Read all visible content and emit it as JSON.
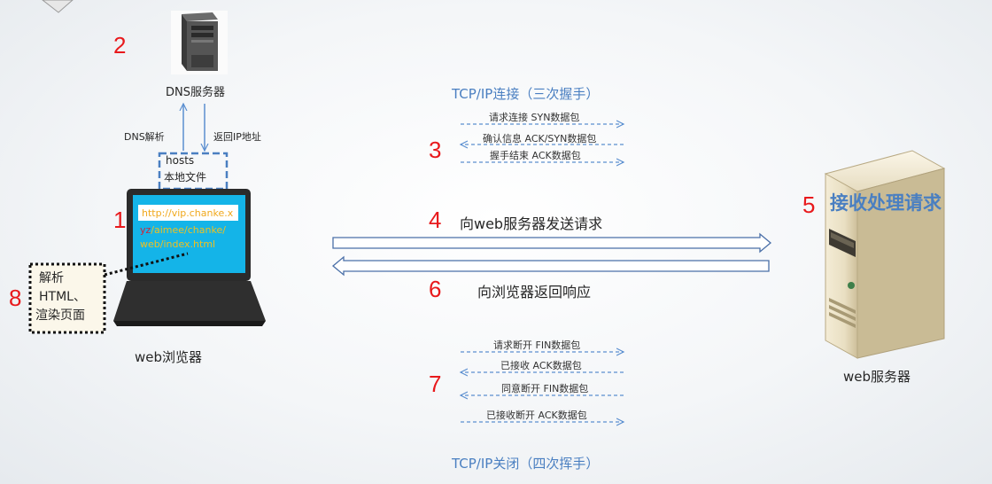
{
  "dns": {
    "number": "2",
    "label": "DNS服务器",
    "resolve_label": "DNS解析",
    "return_label": "返回IP地址"
  },
  "hosts": {
    "line1": "hosts",
    "line2": "本地文件"
  },
  "browser": {
    "number": "1",
    "label": "web浏览器",
    "url_line1": "http://vip.chanke.x",
    "url_line2_a": "yz",
    "url_line2_b": "/aimee/chanke/",
    "url_line3": "web/index.html"
  },
  "render": {
    "number": "8",
    "line1": "解析",
    "line2": "HTML、",
    "line3": "渲染页面"
  },
  "handshake": {
    "title": "TCP/IP连接（三次握手）",
    "number": "3",
    "packets": [
      "请求连接 SYN数据包",
      "确认信息 ACK/SYN数据包",
      "握手结束 ACK数据包"
    ]
  },
  "request": {
    "number": "4",
    "label": "向web服务器发送请求"
  },
  "response": {
    "number": "6",
    "label": "向浏览器返回响应"
  },
  "close": {
    "title": "TCP/IP关闭（四次挥手）",
    "number": "7",
    "packets": [
      "请求断开 FIN数据包",
      "已接收 ACK数据包",
      "同意断开 FIN数据包",
      "已接收断开 ACK数据包"
    ]
  },
  "server": {
    "number": "5",
    "label": "web服务器",
    "process_label": "接收处理请求"
  },
  "colors": {
    "accent_red": "#e8191c",
    "blue": "#4a7fc1",
    "screen": "#14b4e8",
    "arrow_blue": "#5b8fd0"
  }
}
